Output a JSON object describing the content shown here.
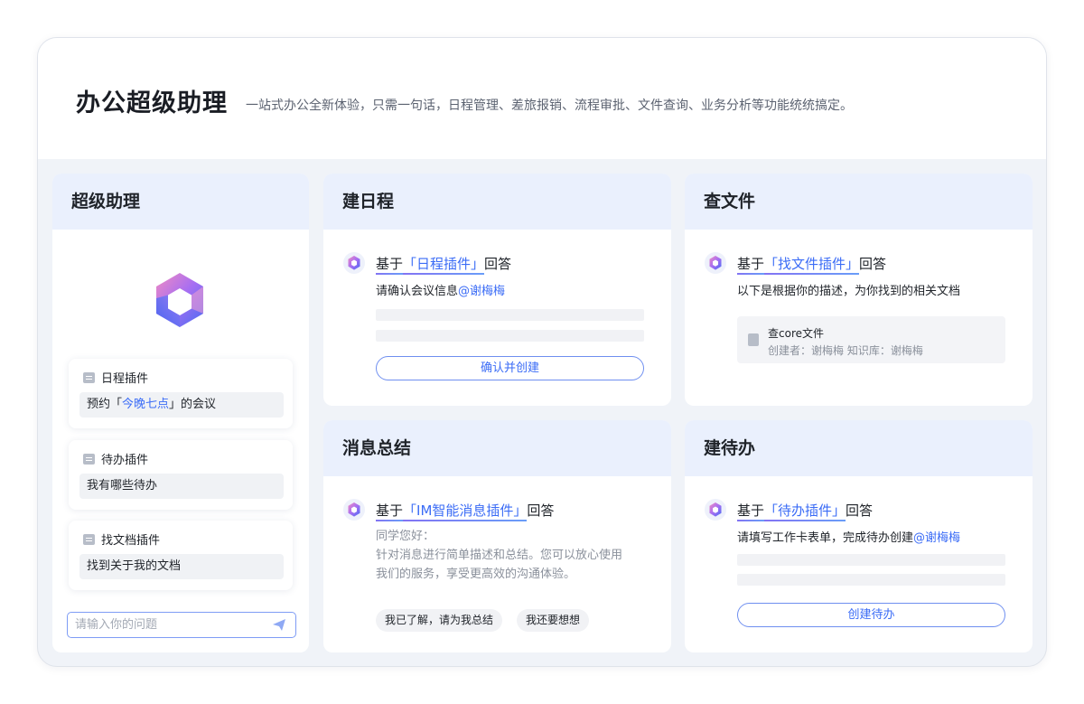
{
  "hero": {
    "title": "办公超级助理",
    "subtitle": "一站式办公全新体验，只需一句话，日程管理、差旅报销、流程审批、文件查询、业务分析等功能统统搞定。"
  },
  "assistant": {
    "title": "超级助理",
    "plugins": [
      {
        "name": "日程插件",
        "prompt_before": "预约「",
        "prompt_highlight": "今晚七点",
        "prompt_after": "」的会议"
      },
      {
        "name": "待办插件",
        "prompt": "我有哪些待办"
      },
      {
        "name": "找文档插件",
        "prompt": "找到关于我的文档"
      }
    ],
    "input_placeholder": "请输入你的问题"
  },
  "schedule": {
    "title": "建日程",
    "reply_prefix": "基于",
    "plugin_link": "「日程插件」",
    "reply_suffix": "回答",
    "message": "请确认会议信息",
    "mention": "@谢梅梅",
    "button": "确认并创建"
  },
  "files": {
    "title": "查文件",
    "reply_prefix": "基于",
    "plugin_link": "「找文件插件」",
    "reply_suffix": "回答",
    "message": "以下是根据你的描述，为你找到的相关文档",
    "file_name": "查core文件",
    "file_meta": "创建者：谢梅梅   知识库：谢梅梅"
  },
  "summary": {
    "title": "消息总结",
    "reply_prefix": "基于",
    "plugin_link": "「IM智能消息插件」",
    "reply_suffix": "回答",
    "greeting": "同学您好：",
    "line1": "针对消息进行简单描述和总结。您可以放心使用",
    "line2": "我们的服务，享受更高效的沟通体验。",
    "chips": [
      "我已了解，请为我总结",
      "我还要想想"
    ]
  },
  "todo": {
    "title": "建待办",
    "reply_prefix": "基于",
    "plugin_link": "「待办插件」",
    "reply_suffix": "回答",
    "message": "请填写工作卡表单，完成待办创建",
    "mention": "@谢梅梅",
    "button": "创建待办"
  },
  "colors": {
    "accent": "#3b6cf6",
    "card_header": "#eaf0fd",
    "background": "#f0f3f8"
  }
}
